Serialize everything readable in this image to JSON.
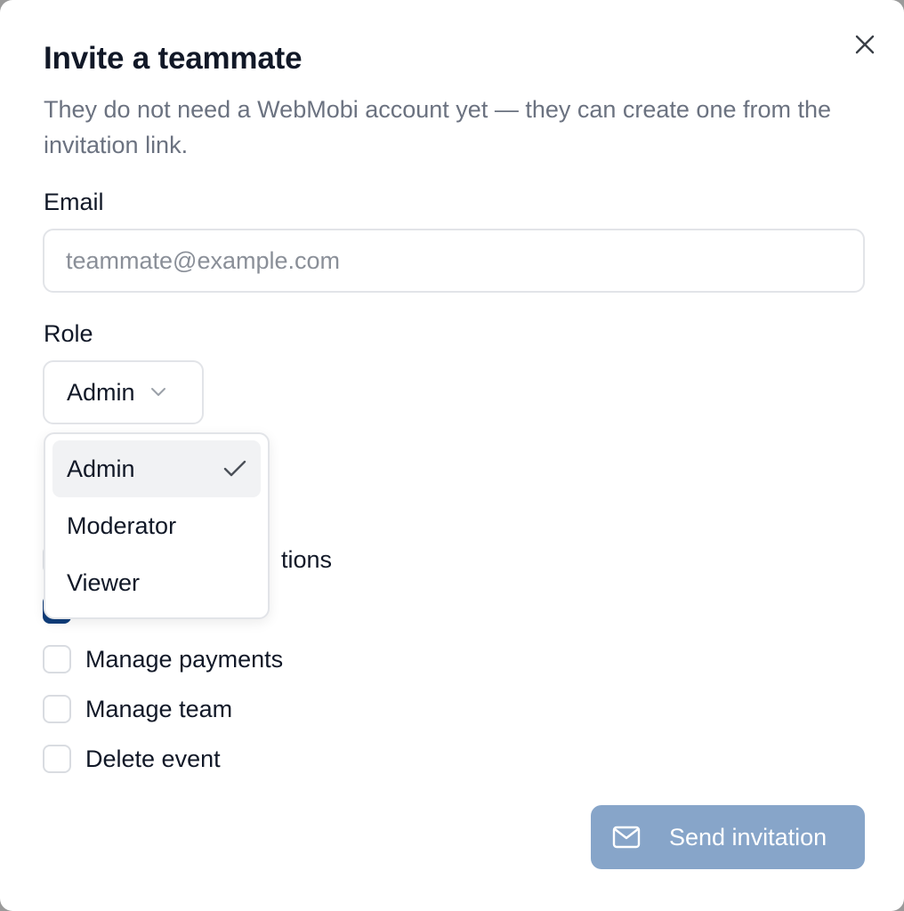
{
  "dialog": {
    "title": "Invite a teammate",
    "subtitle": "They do not need a WebMobi account yet — they can create one from the invitation link."
  },
  "email": {
    "label": "Email",
    "placeholder": "teammate@example.com",
    "value": ""
  },
  "role": {
    "label": "Role",
    "selected": "Admin",
    "options": [
      {
        "label": "Admin",
        "selected": true
      },
      {
        "label": "Moderator",
        "selected": false
      },
      {
        "label": "Viewer",
        "selected": false
      }
    ]
  },
  "permissions": [
    {
      "label": "tions",
      "checked": false
    },
    {
      "label": "",
      "checked": true
    },
    {
      "label": "Manage payments",
      "checked": false
    },
    {
      "label": "Manage team",
      "checked": false
    },
    {
      "label": "Delete event",
      "checked": false
    }
  ],
  "actions": {
    "send_label": "Send invitation",
    "send_icon": "mail-icon",
    "close_icon": "close-icon"
  },
  "colors": {
    "send_button_disabled": "#87a5c9",
    "checkbox_checked": "#0f3d7a",
    "muted_text": "#6b7280"
  }
}
